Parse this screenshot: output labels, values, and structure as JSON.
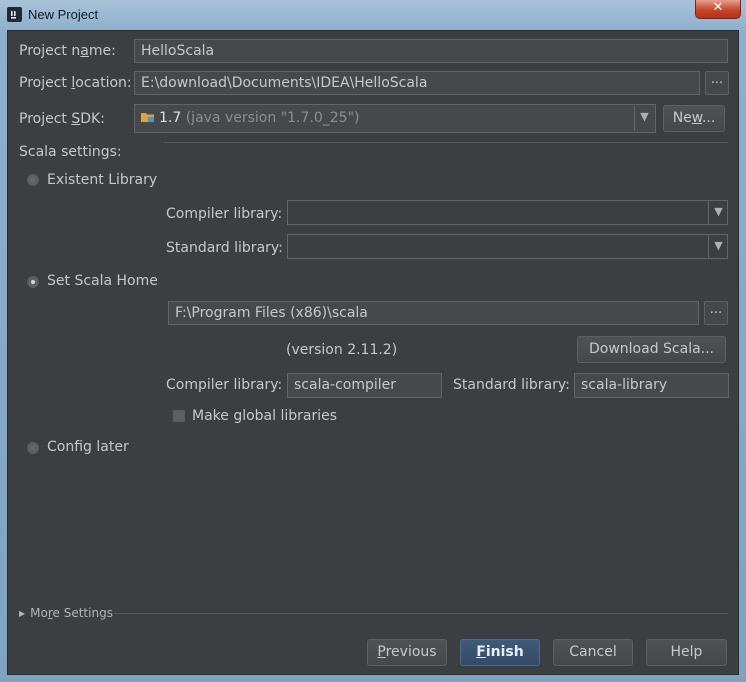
{
  "window": {
    "title": "New Project",
    "close_label": "✕"
  },
  "form": {
    "project_name_label": "Project name:",
    "project_name_value": "HelloScala",
    "project_location_label": "Project location:",
    "project_location_value": "E:\\download\\Documents\\IDEA\\HelloScala",
    "project_sdk_label": "Project SDK:",
    "sdk_version": "1.7",
    "sdk_detail": "(java version \"1.7.0_25\")",
    "new_button": "New...",
    "browse_label": "..."
  },
  "scala": {
    "section_label": "Scala settings:",
    "existent_library_label": "Existent Library",
    "compiler_library_label": "Compiler library:",
    "standard_library_label": "Standard library:",
    "set_scala_home_label": "Set Scala Home",
    "scala_home_path": "F:\\Program Files (x86)\\scala",
    "version_text": "(version 2.11.2)",
    "download_button": "Download Scala...",
    "compiler_library_value": "scala-compiler",
    "standard_library_value": "scala-library",
    "make_global_label": "Make global libraries",
    "config_later_label": "Config later",
    "selected_option": "set-scala-home"
  },
  "more_settings": "More Settings",
  "footer": {
    "previous": "Previous",
    "finish": "Finish",
    "cancel": "Cancel",
    "help": "Help"
  },
  "colors": {
    "dialog_bg": "#3c3f41",
    "field_bg": "#45494a",
    "default_button": "#365880",
    "text": "#c8c8c8"
  }
}
